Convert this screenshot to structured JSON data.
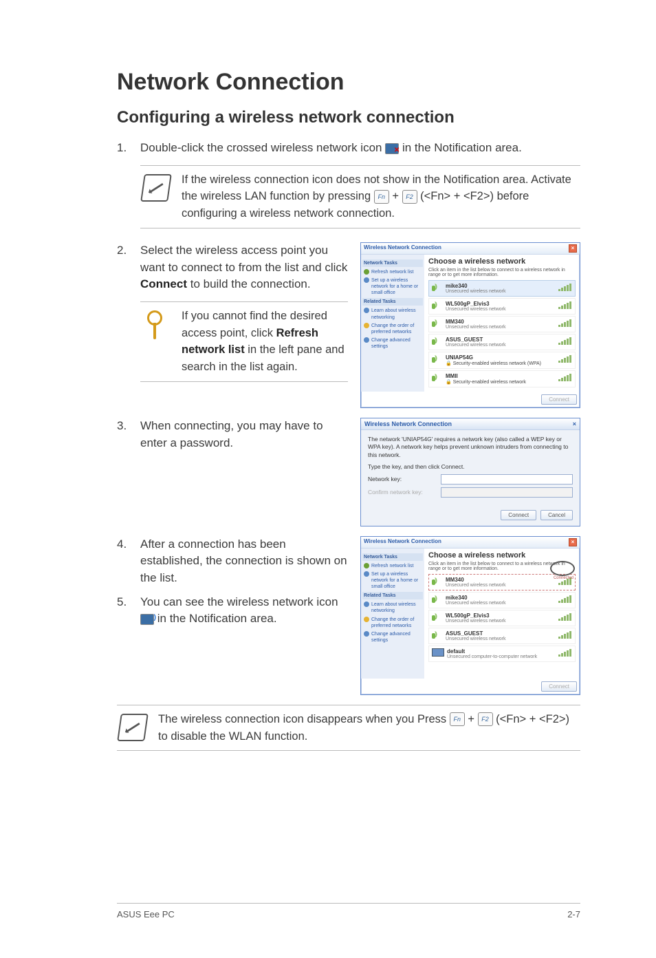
{
  "page": {
    "title": "Network Connection",
    "subtitle": "Configuring a wireless network connection",
    "footer_left": "ASUS Eee PC",
    "footer_right": "2-7"
  },
  "steps": {
    "s1_num": "1.",
    "s1_a": "Double-click the crossed wireless network icon ",
    "s1_b": " in the Notification area.",
    "s2_num": "2.",
    "s2_a": "Select the wireless access point you want to connect to from the list and click ",
    "s2_bold": "Connect",
    "s2_b": " to build the connection.",
    "s3_num": "3.",
    "s3": "When connecting, you may have to enter a password.",
    "s4_num": "4.",
    "s4": "After a connection has been established, the connection is shown on the list.",
    "s5_num": "5.",
    "s5_a": "You can see the wireless network icon ",
    "s5_b": " in the Notification area."
  },
  "notes": {
    "n1_a": "If the wireless connection icon does not show in the Notification area. Activate the wireless LAN function by pressing ",
    "n1_plus": " + ",
    "n1_b": " (<Fn> + <F2>) before configuring a wireless network connection.",
    "n2_a": "If you cannot find the desired access point, click ",
    "n2_bold": "Refresh network list",
    "n2_b": " in the left pane and search in the list again.",
    "n3_a": "The wireless connection icon disappears when you Press ",
    "n3_plus": " + ",
    "n3_b": " (<Fn> + <F2>) to disable the WLAN function."
  },
  "keys": {
    "fn": "Fn",
    "f2": "F2"
  },
  "win": {
    "title": "Wireless Network Connection",
    "heading": "Choose a wireless network",
    "sub": "Click an item in the list below to connect to a wireless network in range or to get more information.",
    "side_hdr1": "Network Tasks",
    "side_refresh": "Refresh network list",
    "side_setup": "Set up a wireless network for a home or small office",
    "side_hdr2": "Related Tasks",
    "side_learn": "Learn about wireless networking",
    "side_order": "Change the order of preferred networks",
    "side_adv": "Change advanced settings",
    "connect_btn": "Connect",
    "connected_badge": "Connected",
    "unsecured": "Unsecured wireless network",
    "sec_wpa": "Security-enabled wireless network (WPA)",
    "sec": "Security-enabled wireless network",
    "adhoc": "Unsecured computer-to-computer network"
  },
  "networks_a": [
    {
      "ssid": "mike340",
      "desc": "Unsecured wireless network",
      "sel": true
    },
    {
      "ssid": "WL500gP_Elvis3",
      "desc": "Unsecured wireless network"
    },
    {
      "ssid": "MM340",
      "desc": "Unsecured wireless network"
    },
    {
      "ssid": "ASUS_GUEST",
      "desc": "Unsecured wireless network"
    },
    {
      "ssid": "UNIAP54G",
      "desc": "Security-enabled wireless network (WPA)",
      "lock": true
    },
    {
      "ssid": "MMII",
      "desc": "Security-enabled wireless network",
      "lock": true
    }
  ],
  "networks_b": [
    {
      "ssid": "MM340",
      "desc": "Unsecured wireless network",
      "connected": true
    },
    {
      "ssid": "mike340",
      "desc": "Unsecured wireless network"
    },
    {
      "ssid": "WL500gP_Elvis3",
      "desc": "Unsecured wireless network"
    },
    {
      "ssid": "ASUS_GUEST",
      "desc": "Unsecured wireless network"
    },
    {
      "ssid": "default",
      "desc": "Unsecured computer-to-computer network",
      "adhoc": true
    }
  ],
  "pw": {
    "title": "Wireless Network Connection",
    "msg": "The network 'UNIAP54G' requires a network key (also called a WEP key or WPA key). A network key helps prevent unknown intruders from connecting to this network.",
    "prompt": "Type the key, and then click Connect.",
    "label1": "Network key:",
    "label2": "Confirm network key:",
    "btn_connect": "Connect",
    "btn_cancel": "Cancel"
  }
}
